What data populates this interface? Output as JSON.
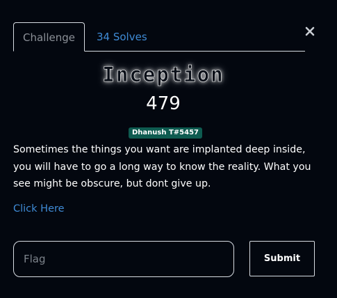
{
  "tabs": {
    "challenge_label": "Challenge",
    "solves_label": "34 Solves"
  },
  "close_icon": "close-icon",
  "challenge": {
    "name": "Inception",
    "points": "479",
    "author": "Dhanush T#5457",
    "description": "Sometimes the things you want are implanted deep inside, you will have to go a long way to know the reality. What you see might be obscure, but dont give up.",
    "link_label": "Click Here"
  },
  "form": {
    "flag_placeholder": "Flag",
    "flag_value": "",
    "submit_label": "Submit"
  },
  "colors": {
    "background": "#03070f",
    "link": "#3f8bd6",
    "badge": "#0e5b50",
    "border": "#d8dde3"
  }
}
